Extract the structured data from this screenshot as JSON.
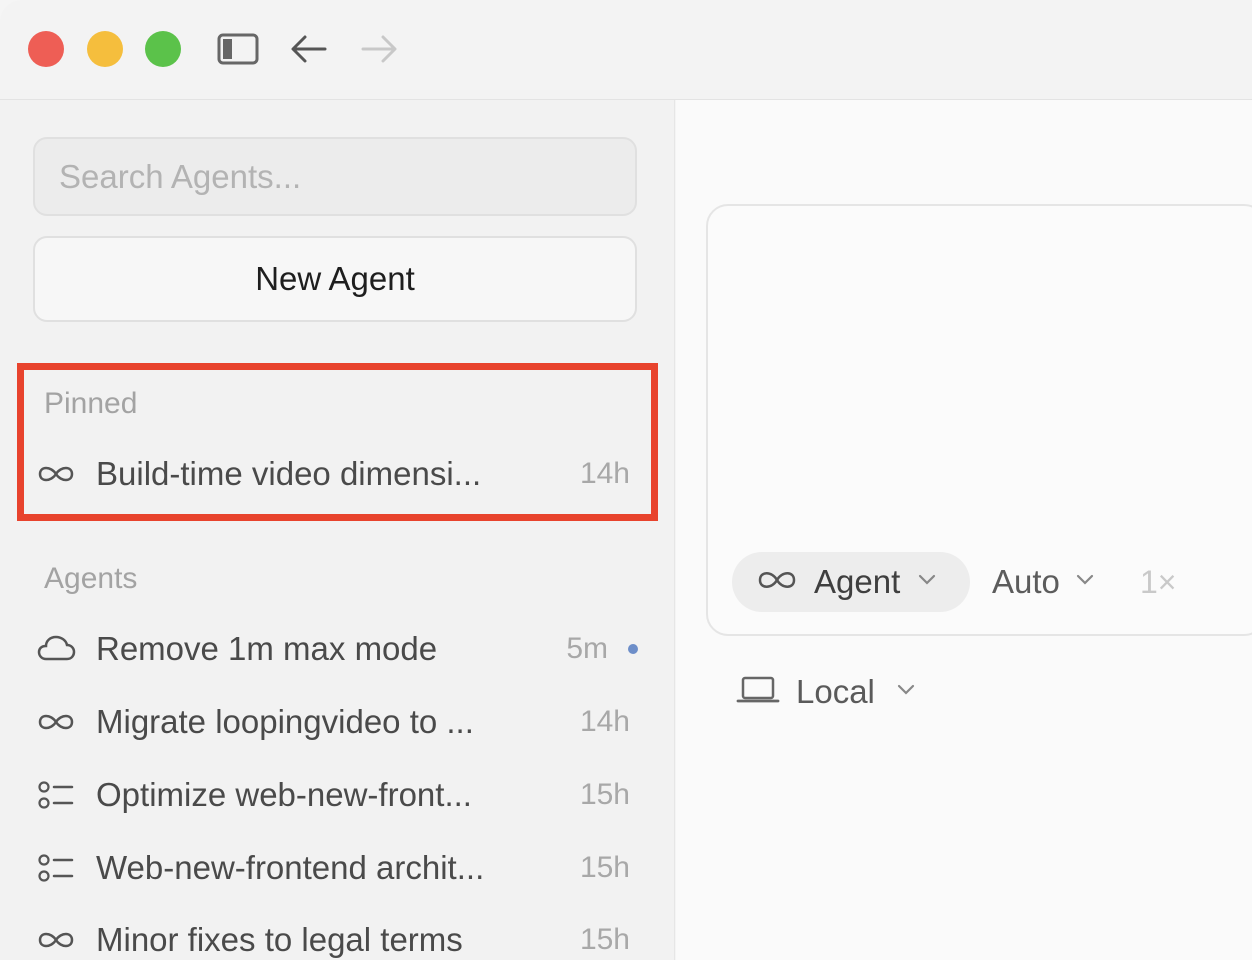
{
  "window": {
    "controls": [
      "close",
      "minimize",
      "zoom"
    ]
  },
  "toolbar": {
    "icons": [
      "sidebar-toggle-icon",
      "back-arrow-icon",
      "forward-arrow-icon"
    ]
  },
  "sidebar": {
    "search_placeholder": "Search Agents...",
    "new_agent_label": "New Agent",
    "pinned": {
      "header": "Pinned",
      "items": [
        {
          "icon": "infinity-icon",
          "title": "Build-time video dimensi...",
          "time": "14h"
        }
      ]
    },
    "agents": {
      "header": "Agents",
      "items": [
        {
          "icon": "cloud-icon",
          "title": "Remove 1m max mode",
          "time": "5m",
          "unread": true
        },
        {
          "icon": "infinity-icon",
          "title": "Migrate loopingvideo to ...",
          "time": "14h"
        },
        {
          "icon": "checklist-icon",
          "title": "Optimize web-new-front...",
          "time": "15h"
        },
        {
          "icon": "checklist-icon",
          "title": "Web-new-frontend archit...",
          "time": "15h"
        },
        {
          "icon": "infinity-icon",
          "title": "Minor fixes to legal terms",
          "time": "15h"
        }
      ]
    }
  },
  "composer": {
    "mode_label": "Agent",
    "model_label": "Auto",
    "multiplier": "1×",
    "environment_label": "Local"
  },
  "colors": {
    "highlight": "#e8432d",
    "unread_dot": "#6d8ec9",
    "close": "#ee5e55",
    "minimize": "#f5be3d",
    "zoom": "#5bc24a"
  }
}
